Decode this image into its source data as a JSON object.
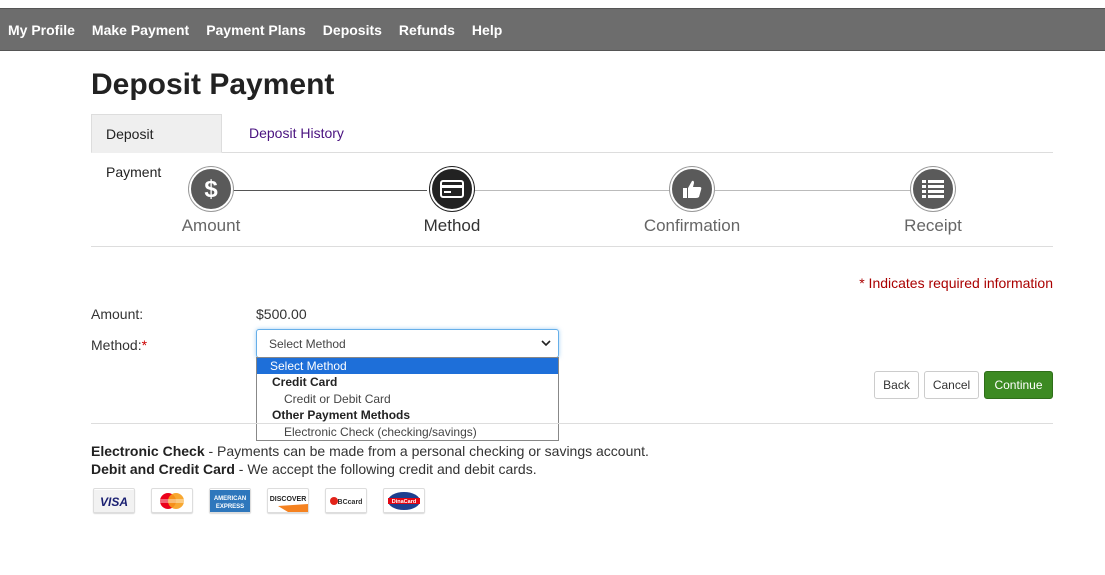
{
  "nav": {
    "items": [
      "My Profile",
      "Make Payment",
      "Payment Plans",
      "Deposits",
      "Refunds",
      "Help"
    ]
  },
  "page": {
    "title": "Deposit Payment"
  },
  "tabs": [
    {
      "label": "Deposit Payment",
      "active": true
    },
    {
      "label": "Deposit History",
      "active": false
    }
  ],
  "steps": [
    {
      "label": "Amount",
      "icon": "dollar-icon",
      "state": "completed"
    },
    {
      "label": "Method",
      "icon": "credit-card-icon",
      "state": "current"
    },
    {
      "label": "Confirmation",
      "icon": "thumbs-up-icon",
      "state": "pending"
    },
    {
      "label": "Receipt",
      "icon": "list-icon",
      "state": "pending"
    }
  ],
  "form": {
    "required_note": "* Indicates required information",
    "amount_label": "Amount:",
    "amount_value": "$500.00",
    "method_label": "Method:",
    "required_marker": "*",
    "method_selected": "Select Method"
  },
  "dropdown": {
    "options": [
      {
        "text": "Select Method",
        "kind": "option",
        "selected": true
      },
      {
        "text": "Credit Card",
        "kind": "group"
      },
      {
        "text": "Credit or Debit Card",
        "kind": "sub"
      },
      {
        "text": "Other Payment Methods",
        "kind": "group"
      },
      {
        "text": "Electronic Check (checking/savings)",
        "kind": "sub"
      }
    ]
  },
  "buttons": {
    "back": "Back",
    "cancel": "Cancel",
    "continue": "Continue"
  },
  "info": {
    "echeck_title": "Electronic Check",
    "echeck_text": " - Payments can be made from a personal checking or savings account.",
    "card_title": "Debit and Credit Card",
    "card_text": " - We accept the following credit and debit cards."
  },
  "cards": [
    {
      "name": "VISA",
      "icon": "visa-logo"
    },
    {
      "name": "MasterCard",
      "icon": "mastercard-logo"
    },
    {
      "name": "AMERICAN EXPRESS",
      "icon": "amex-logo"
    },
    {
      "name": "DISCOVER",
      "icon": "discover-logo"
    },
    {
      "name": "BCcard",
      "icon": "bccard-logo"
    },
    {
      "name": "DinaCard",
      "icon": "dinacard-logo"
    }
  ],
  "colors": {
    "topbar": "#6d6d6d",
    "accent_link": "#4a1380",
    "required": "#aa0000",
    "primary_button": "#3c8a22",
    "selected_option": "#1e6fd9"
  }
}
